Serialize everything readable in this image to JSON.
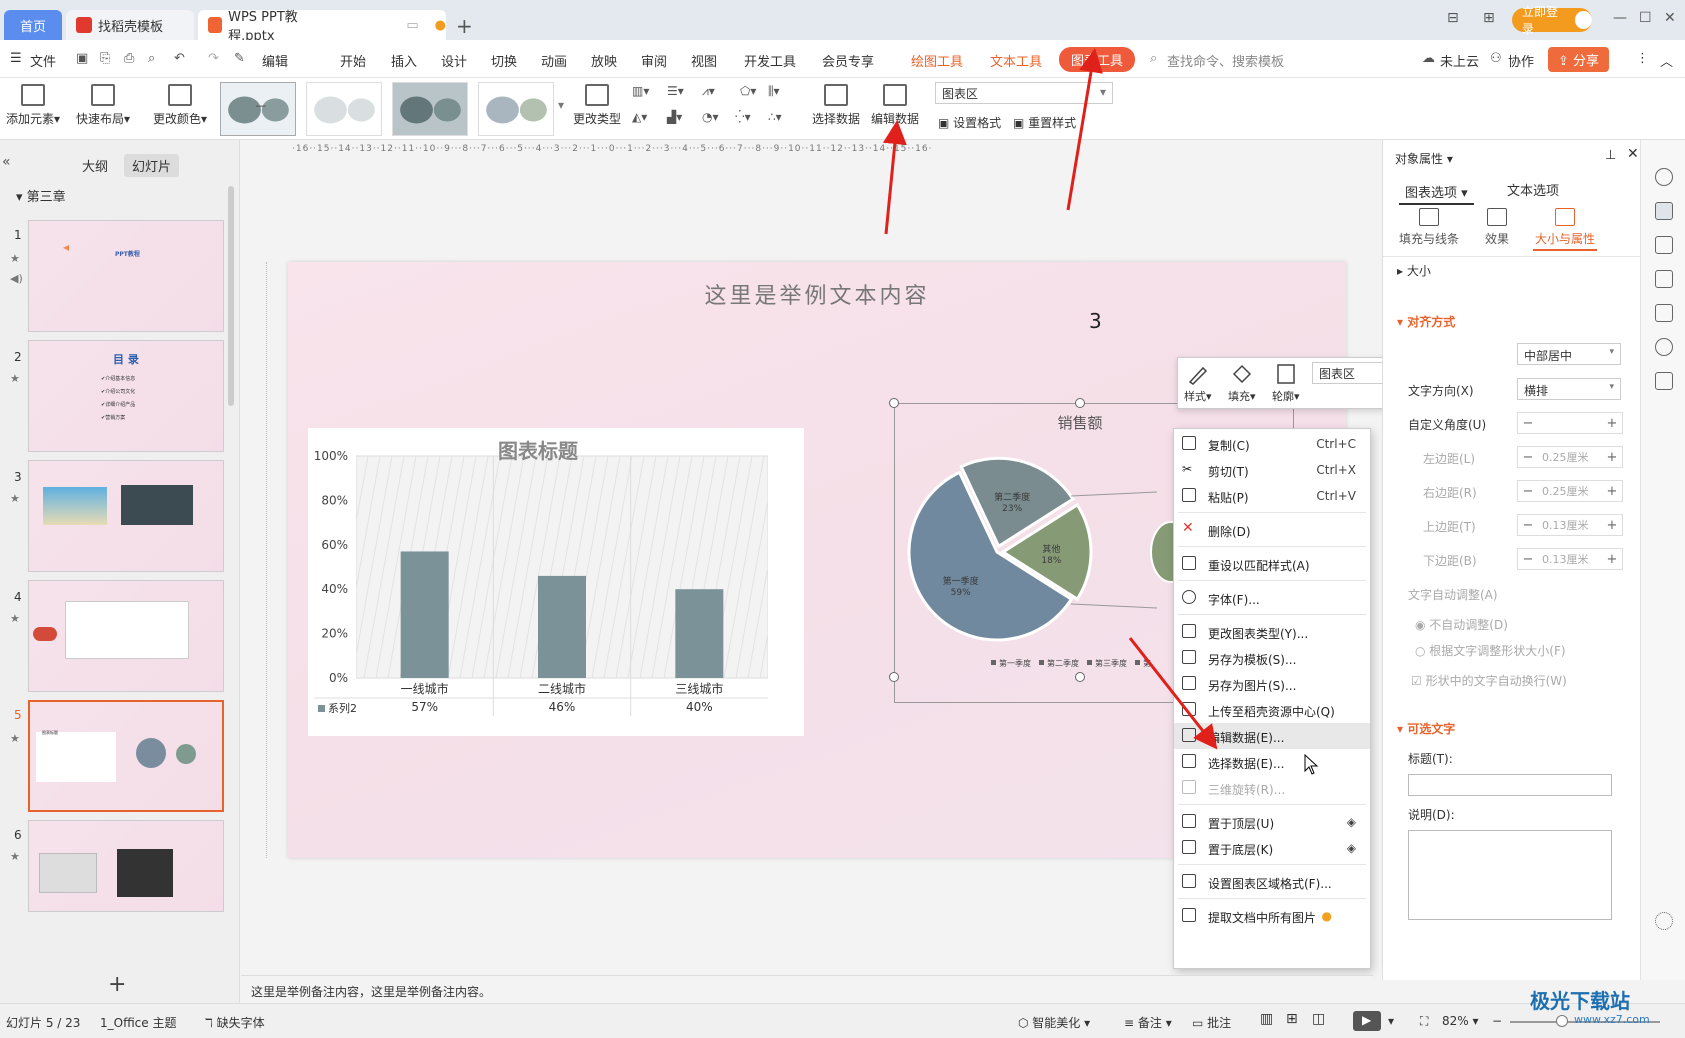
{
  "tabs": {
    "home": "首页",
    "template": "找稻壳模板",
    "document": "WPS PPT教程.pptx",
    "login": "立即登录"
  },
  "menu": {
    "file": "文件",
    "edit": "编辑",
    "items": [
      "开始",
      "插入",
      "设计",
      "切换",
      "动画",
      "放映",
      "审阅",
      "视图",
      "开发工具",
      "会员专享"
    ],
    "drawing_tools": "绘图工具",
    "text_tools": "文本工具",
    "chart_tools": "图表工具",
    "search": "查找命令、搜索模板",
    "cloud": "未上云",
    "collab": "协作",
    "share": "分享"
  },
  "ribbon": {
    "add_element": "添加元素",
    "quick_layout": "快速布局",
    "change_color": "更改颜色",
    "change_type": "更改类型",
    "select_data": "选择数据",
    "edit_data": "编辑数据",
    "chart_area": "图表区",
    "set_format": "设置格式",
    "reset_style": "重置样式"
  },
  "left_panel": {
    "outline": "大纲",
    "slides": "幻灯片",
    "section": "第三章",
    "slide_numbers": [
      "1",
      "2",
      "3",
      "4",
      "5",
      "6"
    ],
    "slide1_title": "PPT教程",
    "slide2_title": "目 录",
    "slide2_items": [
      "✔介绍基本信息",
      "✔介绍公司文化",
      "✔详细介绍产品",
      "✔营销方案"
    ],
    "slide5_title": "图表标题"
  },
  "slide": {
    "title": "这里是举例文本内容",
    "number": "3"
  },
  "chart_data": [
    {
      "type": "bar",
      "title": "图表标题",
      "categories": [
        "一线城市",
        "二线城市",
        "三线城市"
      ],
      "series": [
        {
          "name": "系列2",
          "values": [
            0.57,
            0.46,
            0.4
          ]
        }
      ],
      "value_labels": [
        "57%",
        "46%",
        "40%"
      ],
      "y_ticks": [
        "100%",
        "80%",
        "60%",
        "40%",
        "20%",
        "0%"
      ],
      "ylim": [
        0,
        1
      ],
      "color": "#7a9298"
    },
    {
      "type": "pie",
      "title": "销售额",
      "slices": [
        {
          "label": "第一季度",
          "percent": "59%",
          "value": 59,
          "color": "#71899e"
        },
        {
          "label": "第二季度",
          "percent": "23%",
          "value": 23,
          "color": "#7a8c8f"
        },
        {
          "label": "其他",
          "percent": "18%",
          "value": 18,
          "color": "#869a76"
        }
      ],
      "legend": [
        "第一季度",
        "第二季度",
        "第三季度",
        "第"
      ]
    }
  ],
  "mini_toolbar": {
    "style": "样式",
    "fill": "填充",
    "outline": "轮廓",
    "select": "图表区"
  },
  "context_menu": [
    {
      "label": "复制(C)",
      "shortcut": "Ctrl+C"
    },
    {
      "label": "剪切(T)",
      "shortcut": "Ctrl+X"
    },
    {
      "label": "粘贴(P)",
      "shortcut": "Ctrl+V"
    },
    {
      "label": "删除(D)",
      "shortcut": ""
    },
    {
      "label": "重设以匹配样式(A)",
      "shortcut": ""
    },
    {
      "label": "字体(F)...",
      "shortcut": ""
    },
    {
      "label": "更改图表类型(Y)...",
      "shortcut": ""
    },
    {
      "label": "另存为模板(S)...",
      "shortcut": ""
    },
    {
      "label": "另存为图片(S)...",
      "shortcut": ""
    },
    {
      "label": "上传至稻壳资源中心(Q)",
      "shortcut": ""
    },
    {
      "label": "编辑数据(E)...",
      "shortcut": ""
    },
    {
      "label": "选择数据(E)...",
      "shortcut": ""
    },
    {
      "label": "三维旋转(R)...",
      "shortcut": ""
    },
    {
      "label": "置于顶层(U)",
      "shortcut": ""
    },
    {
      "label": "置于底层(K)",
      "shortcut": ""
    },
    {
      "label": "设置图表区域格式(F)...",
      "shortcut": ""
    },
    {
      "label": "提取文档中所有图片",
      "shortcut": ""
    }
  ],
  "right_panel": {
    "header": "对象属性",
    "tab_chart": "图表选项",
    "tab_text": "文本选项",
    "sub_fill": "填充与线条",
    "sub_effect": "效果",
    "sub_size": "大小与属性",
    "size": "大小",
    "align": "对齐方式",
    "valign_value": "中部居中",
    "text_direction": "文字方向(X)",
    "text_direction_value": "横排",
    "custom_angle": "自定义角度(U)",
    "left_margin": "左边距(L)",
    "right_margin": "右边距(R)",
    "top_margin": "上边距(T)",
    "bottom_margin": "下边距(B)",
    "margin_lr": "0.25厘米",
    "margin_tb": "0.13厘米",
    "autofit": "文字自动调整(A)",
    "no_autofit": "不自动调整(D)",
    "resize_shape": "根据文字调整形状大小(F)",
    "wrap_text": "形状中的文字自动换行(W)",
    "alt_text": "可选文字",
    "title_label": "标题(T):",
    "desc_label": "说明(D):"
  },
  "notes": "这里是举例备注内容，这里是举例备注内容。",
  "status": {
    "slide": "幻灯片 5 / 23",
    "theme": "1_Office 主题",
    "missing_font": "缺失字体",
    "smart_beautify": "智能美化",
    "notes": "备注",
    "comments": "批注",
    "zoom": "82%"
  },
  "watermark": "极光下载站",
  "watermark_url": "www.xz7.com"
}
